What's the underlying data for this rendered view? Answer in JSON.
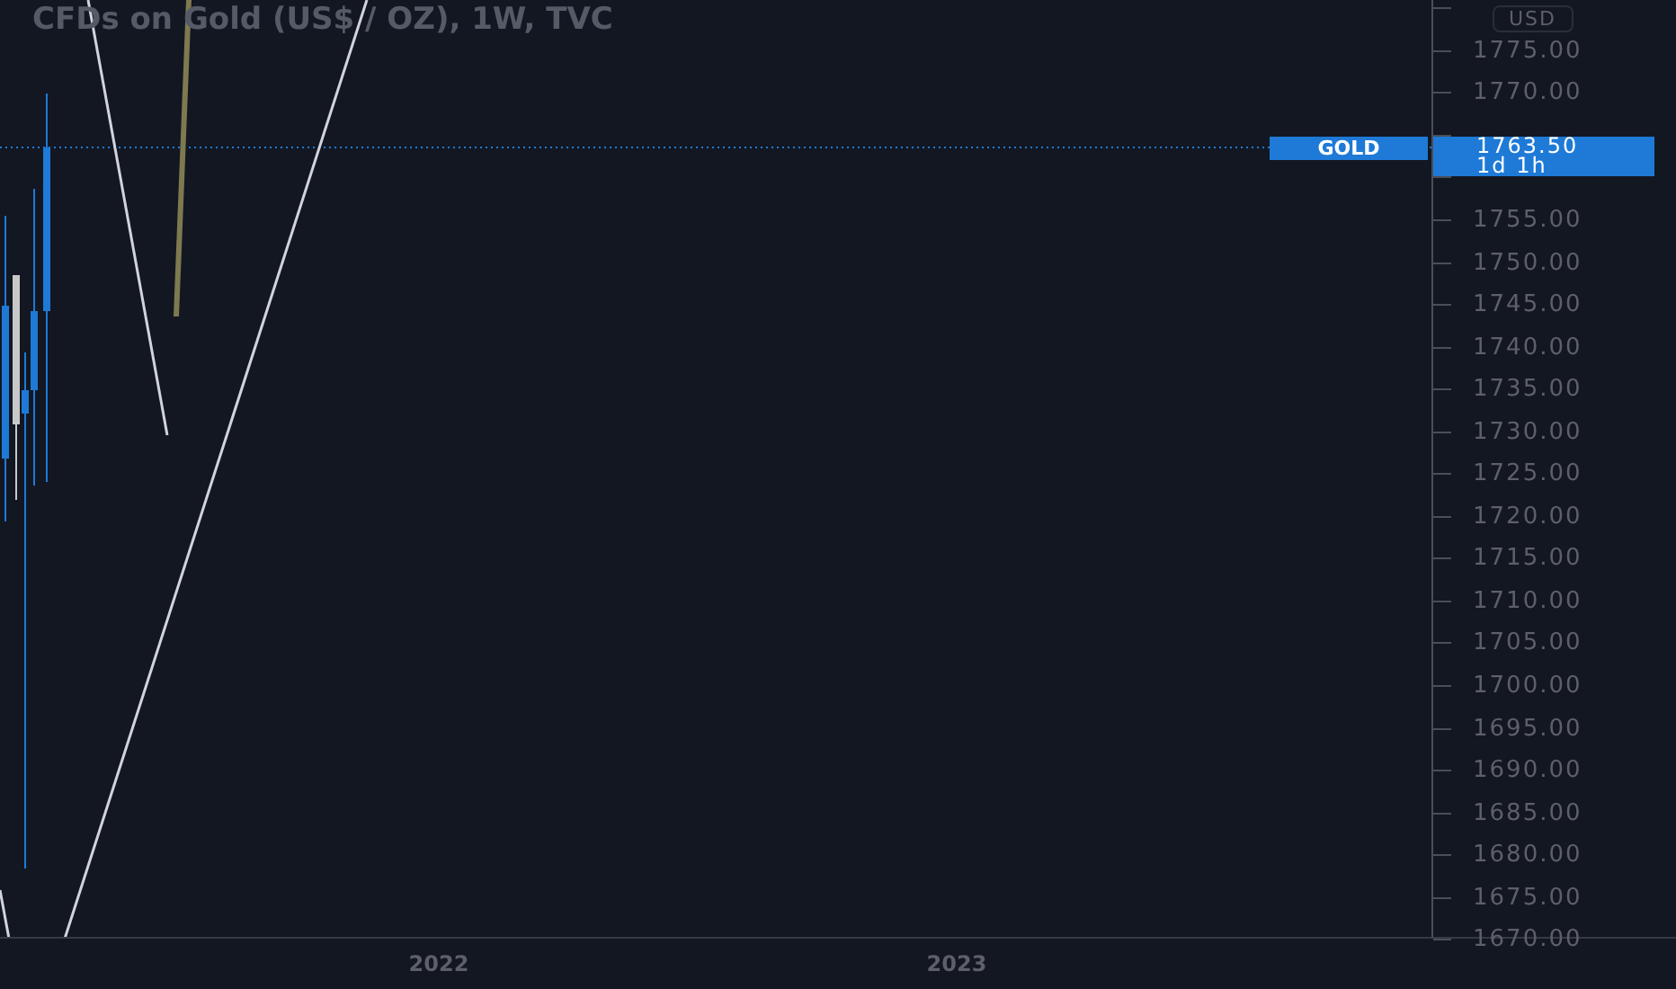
{
  "chart": {
    "title": "CFDs on Gold (US$ / OZ), 1W, TVC",
    "symbol_tag": "GOLD",
    "currency": "USD"
  },
  "price_label": {
    "price": "1763.50",
    "countdown": "1d 1h"
  },
  "price_axis": {
    "ticks": [
      {
        "kind": "covered"
      },
      {
        "kind": "label",
        "text": "1775.00"
      },
      {
        "kind": "label",
        "text": "1770.00"
      },
      {
        "kind": "covered"
      },
      {
        "kind": "covered"
      },
      {
        "kind": "label",
        "text": "1755.00"
      },
      {
        "kind": "label",
        "text": "1750.00"
      },
      {
        "kind": "label",
        "text": "1745.00"
      },
      {
        "kind": "label",
        "text": "1740.00"
      },
      {
        "kind": "label",
        "text": "1735.00"
      },
      {
        "kind": "label",
        "text": "1730.00"
      },
      {
        "kind": "label",
        "text": "1725.00"
      },
      {
        "kind": "label",
        "text": "1720.00"
      },
      {
        "kind": "label",
        "text": "1715.00"
      },
      {
        "kind": "label",
        "text": "1710.00"
      },
      {
        "kind": "label",
        "text": "1705.00"
      },
      {
        "kind": "label",
        "text": "1700.00"
      },
      {
        "kind": "label",
        "text": "1695.00"
      },
      {
        "kind": "label",
        "text": "1690.00"
      },
      {
        "kind": "label",
        "text": "1685.00"
      },
      {
        "kind": "label",
        "text": "1680.00"
      },
      {
        "kind": "label",
        "text": "1675.00"
      },
      {
        "kind": "label",
        "text": "1670.00"
      }
    ]
  },
  "time_axis": {
    "labels": [
      "2022",
      "2023"
    ]
  }
}
